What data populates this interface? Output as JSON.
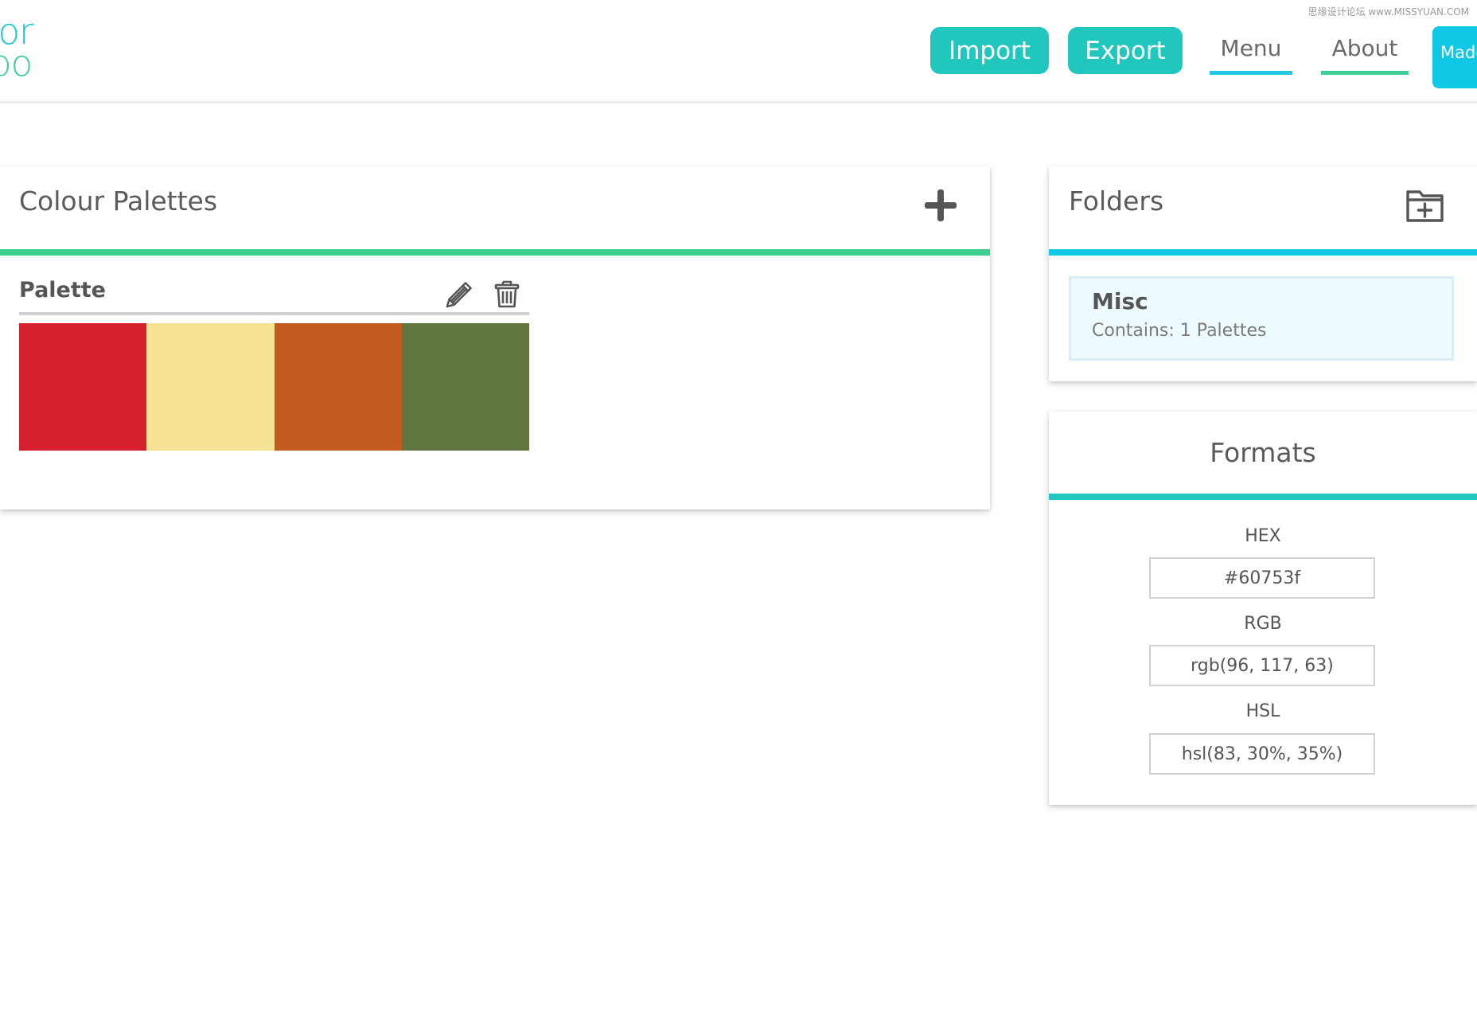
{
  "header": {
    "logo": {
      "line1": "lor",
      "line2": "bo"
    },
    "watermark": "思缘设计论坛 www.MISSYUAN.COM",
    "import_label": "Import",
    "export_label": "Export",
    "nav": {
      "menu_label": "Menu",
      "about_label": "About"
    },
    "made_label": "Made"
  },
  "palettes": {
    "title": "Colour Palettes",
    "accent_color": "#3ccf8e",
    "items": [
      {
        "name": "Palette",
        "colors": [
          "#d81f30",
          "#f5e295",
          "#c25c1e",
          "#60753f"
        ]
      }
    ]
  },
  "folders": {
    "title": "Folders",
    "accent_color": "#11c8e6",
    "items": [
      {
        "name": "Misc",
        "contains": "Contains: 1 Palettes"
      }
    ]
  },
  "formats": {
    "title": "Formats",
    "accent_color": "#21c6bd",
    "hex_label": "HEX",
    "hex_value": "#60753f",
    "rgb_label": "RGB",
    "rgb_value": "rgb(96, 117, 63)",
    "hsl_label": "HSL",
    "hsl_value": "hsl(83, 30%, 35%)"
  },
  "icons": [
    "plus-icon",
    "folder-plus-icon",
    "pencil-icon",
    "trash-icon"
  ]
}
